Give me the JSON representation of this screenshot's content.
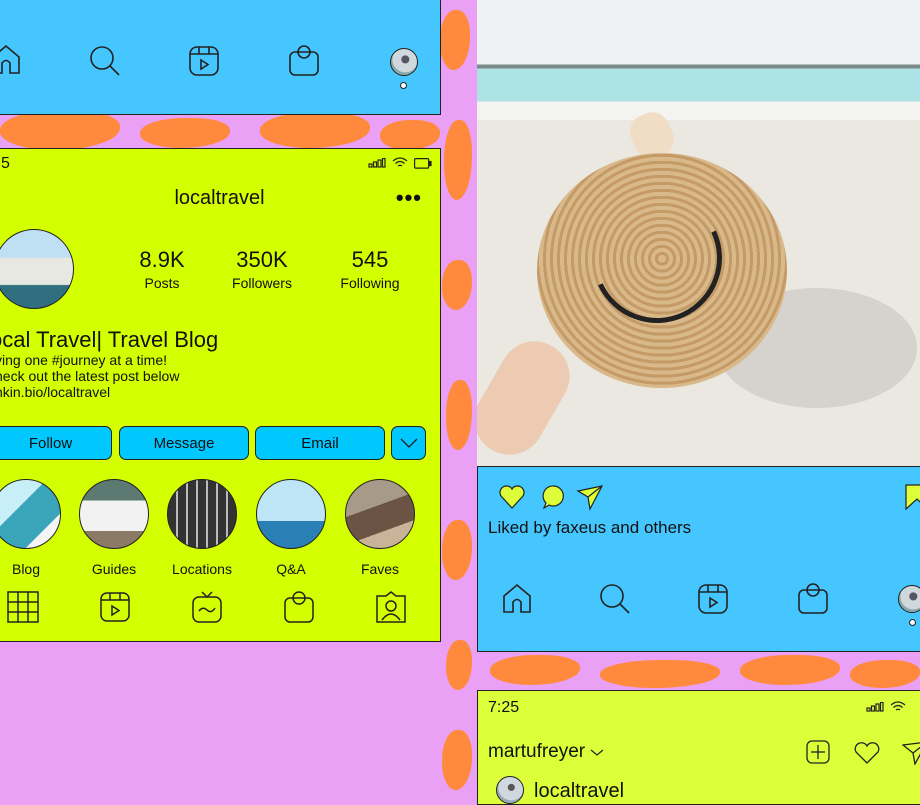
{
  "colors": {
    "nav_blue": "#45c6ff",
    "profile_lime": "#d4ff00",
    "button_blue": "#00c8ff",
    "pattern_orange": "#ff8a3d",
    "pattern_pink": "#e9a0f5"
  },
  "top_nav": {
    "icons": [
      "home-icon",
      "search-icon",
      "reels-icon",
      "shop-icon",
      "profile-avatar"
    ]
  },
  "profile": {
    "status_time": "5",
    "username": "localtravel",
    "more_label": "•••",
    "stats": [
      {
        "value": "8.9K",
        "label": "Posts"
      },
      {
        "value": "350K",
        "label": "Followers"
      },
      {
        "value": "545",
        "label": "Following"
      }
    ],
    "bio_title": "ocal Travel| Travel Blog",
    "bio_lines": [
      "ving one #journey at a time!",
      "heck out the latest post below",
      "nkin.bio/localtravel"
    ],
    "buttons": {
      "follow": "Follow",
      "message": "Message",
      "email": "Email"
    },
    "highlights": [
      {
        "label": "Blog"
      },
      {
        "label": "Guides"
      },
      {
        "label": "Locations"
      },
      {
        "label": "Q&A"
      },
      {
        "label": "Faves"
      }
    ],
    "tabs": [
      "grid-icon",
      "reels-icon",
      "igtv-icon",
      "shop-icon",
      "tagged-icon"
    ]
  },
  "post": {
    "liked_text": "Liked by faxeus and others"
  },
  "feed": {
    "status_time": "7:25",
    "account_switcher": "martufreyer",
    "post_user": "localtravel"
  }
}
